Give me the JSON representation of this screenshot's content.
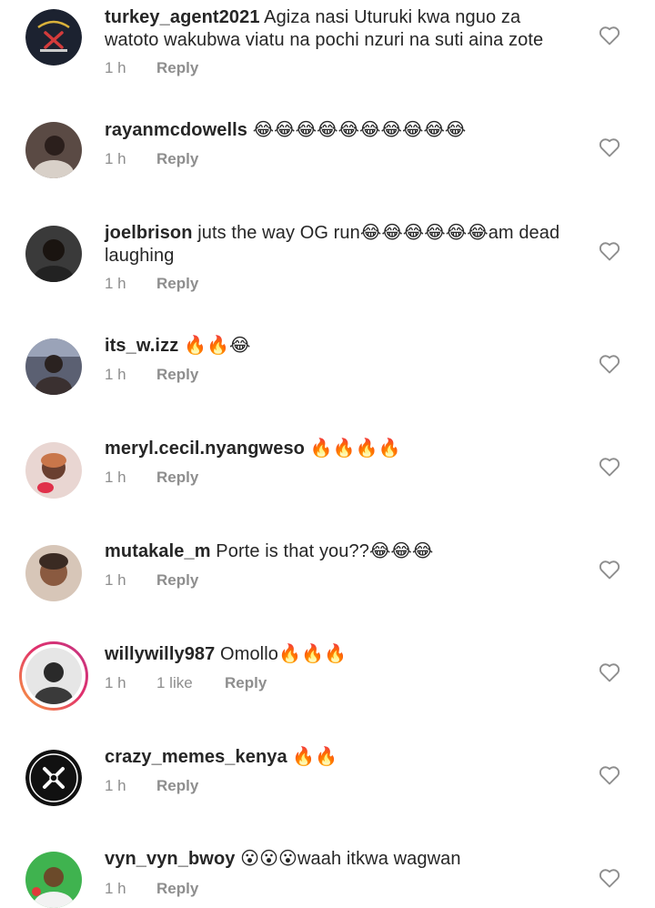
{
  "comments": [
    {
      "username": "turkey_agent2021",
      "text": " Agiza nasi Uturuki kwa nguo za watoto wakubwa viatu na pochi nzuri na suti aina zote",
      "time": "1 h",
      "reply": "Reply",
      "avatar": "emblem-dark",
      "avatar_color": "#1c2230"
    },
    {
      "username": "rayanmcdowells",
      "text": " 😂😂😂😂😂😂😂😂😂😂",
      "time": "1 h",
      "reply": "Reply",
      "avatar": "photo-person",
      "avatar_color": "#5a4a44"
    },
    {
      "username": "joelbrison",
      "text": " juts the way OG run😂😂😂😂😂😂am dead laughing",
      "time": "1 h",
      "reply": "Reply",
      "avatar": "photo-person",
      "avatar_color": "#3a3a3a"
    },
    {
      "username": "its_w.izz",
      "text": " 🔥🔥😂",
      "time": "1 h",
      "reply": "Reply",
      "avatar": "photo-person",
      "avatar_color": "#5b6072"
    },
    {
      "username": "meryl.cecil.nyangweso",
      "text": " 🔥🔥🔥🔥",
      "time": "1 h",
      "reply": "Reply",
      "avatar": "photo-person",
      "avatar_color": "#c98a8a"
    },
    {
      "username": "mutakale_m",
      "text": " Porte is that you??😂😂😂",
      "time": "1 h",
      "reply": "Reply",
      "avatar": "photo-person",
      "avatar_color": "#8a7060"
    },
    {
      "username": "willywilly987",
      "text": " Omollo🔥🔥🔥",
      "time": "1 h",
      "likes": "1 like",
      "reply": "Reply",
      "avatar": "photo-person",
      "avatar_color": "#6e6e6e"
    },
    {
      "username": "crazy_memes_kenya",
      "text": " 🔥🔥",
      "time": "1 h",
      "reply": "Reply",
      "avatar": "emblem-black",
      "avatar_color": "#111111"
    },
    {
      "username": "vyn_vyn_bwoy",
      "text": " 😮😮😮waah itkwa wagwan",
      "time": "1 h",
      "reply": "Reply",
      "avatar": "photo-person",
      "avatar_color": "#3fb34f"
    }
  ],
  "colors": {
    "meta_text": "#8e8e8e",
    "primary_text": "#262626",
    "story_ring": "#e1306c"
  }
}
